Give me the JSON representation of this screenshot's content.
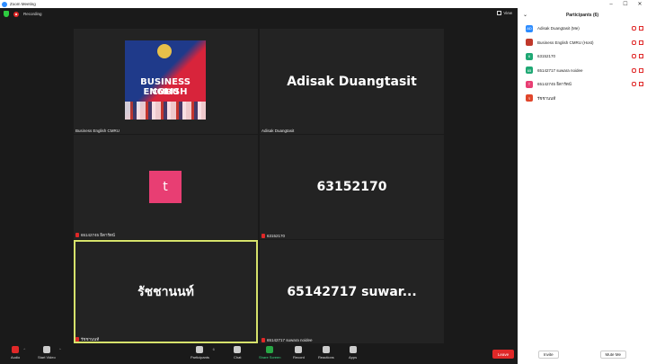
{
  "window": {
    "title": "Zoom Meeting",
    "controls": [
      "–",
      "☐",
      "✕"
    ]
  },
  "meeting": {
    "recording_label": "Recording",
    "view_label": "View",
    "tiles": [
      {
        "name": "Business English CMRU",
        "logo_line1": "BUSINESS ENGLISH",
        "logo_line2": "CMRU"
      },
      {
        "name": "Adisak Duangtasit",
        "display": "Adisak Duangtasit"
      },
      {
        "name": "65142745 ธิดารัตน์",
        "avatar_letter": "t",
        "avatar_color": "#e83e73"
      },
      {
        "name": "63152170",
        "display": "63152170"
      },
      {
        "name": "รัชชานนท์",
        "display": "รัชชานนท์",
        "selected": true
      },
      {
        "name": "65142717 suwara noidee",
        "display": "65142717  suwar..."
      }
    ]
  },
  "toolbar": {
    "audio": "Audio",
    "video": "Start Video",
    "participants": "Participants",
    "participants_count": "6",
    "chat": "Chat",
    "share": "Share Screen",
    "record": "Record",
    "reactions": "Reactions",
    "apps": "Apps",
    "leave": "Leave"
  },
  "panel": {
    "title": "Participants (6)",
    "participants": [
      {
        "initials": "AD",
        "color": "#2d8cff",
        "name": "Adisak Duangtasit (Me)"
      },
      {
        "initials": "",
        "color": "#c0392b",
        "name": "Business English CMRU (Host)"
      },
      {
        "initials": "6",
        "color": "#1fa874",
        "name": "63152170"
      },
      {
        "initials": "65",
        "color": "#1fa874",
        "name": "65142717 suwara noidee"
      },
      {
        "initials": "T",
        "color": "#e83e73",
        "name": "65142745 ธิดารัตน์"
      },
      {
        "initials": "ร",
        "color": "#e0462b",
        "name": "รัชชานนท์"
      }
    ],
    "invite": "Invite",
    "mute_me": "Mute Me"
  },
  "colors": {
    "accent": "#2d8cff",
    "danger": "#e02828",
    "share": "#3ddc84",
    "active_border": "#d6e26b"
  }
}
